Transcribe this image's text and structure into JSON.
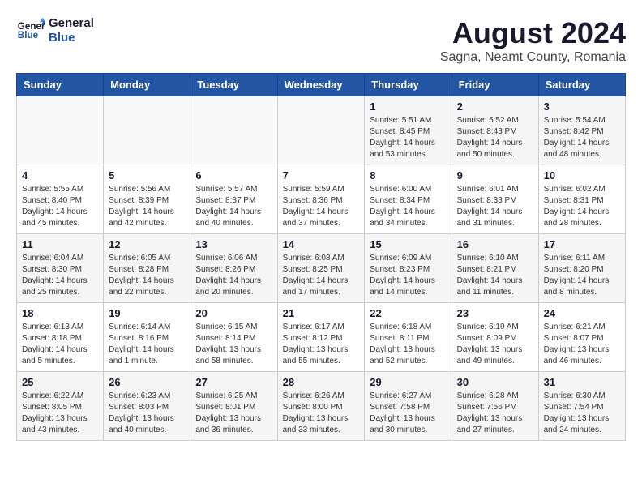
{
  "logo": {
    "line1": "General",
    "line2": "Blue"
  },
  "title": "August 2024",
  "subtitle": "Sagna, Neamt County, Romania",
  "weekdays": [
    "Sunday",
    "Monday",
    "Tuesday",
    "Wednesday",
    "Thursday",
    "Friday",
    "Saturday"
  ],
  "weeks": [
    [
      {
        "day": "",
        "info": ""
      },
      {
        "day": "",
        "info": ""
      },
      {
        "day": "",
        "info": ""
      },
      {
        "day": "",
        "info": ""
      },
      {
        "day": "1",
        "info": "Sunrise: 5:51 AM\nSunset: 8:45 PM\nDaylight: 14 hours\nand 53 minutes."
      },
      {
        "day": "2",
        "info": "Sunrise: 5:52 AM\nSunset: 8:43 PM\nDaylight: 14 hours\nand 50 minutes."
      },
      {
        "day": "3",
        "info": "Sunrise: 5:54 AM\nSunset: 8:42 PM\nDaylight: 14 hours\nand 48 minutes."
      }
    ],
    [
      {
        "day": "4",
        "info": "Sunrise: 5:55 AM\nSunset: 8:40 PM\nDaylight: 14 hours\nand 45 minutes."
      },
      {
        "day": "5",
        "info": "Sunrise: 5:56 AM\nSunset: 8:39 PM\nDaylight: 14 hours\nand 42 minutes."
      },
      {
        "day": "6",
        "info": "Sunrise: 5:57 AM\nSunset: 8:37 PM\nDaylight: 14 hours\nand 40 minutes."
      },
      {
        "day": "7",
        "info": "Sunrise: 5:59 AM\nSunset: 8:36 PM\nDaylight: 14 hours\nand 37 minutes."
      },
      {
        "day": "8",
        "info": "Sunrise: 6:00 AM\nSunset: 8:34 PM\nDaylight: 14 hours\nand 34 minutes."
      },
      {
        "day": "9",
        "info": "Sunrise: 6:01 AM\nSunset: 8:33 PM\nDaylight: 14 hours\nand 31 minutes."
      },
      {
        "day": "10",
        "info": "Sunrise: 6:02 AM\nSunset: 8:31 PM\nDaylight: 14 hours\nand 28 minutes."
      }
    ],
    [
      {
        "day": "11",
        "info": "Sunrise: 6:04 AM\nSunset: 8:30 PM\nDaylight: 14 hours\nand 25 minutes."
      },
      {
        "day": "12",
        "info": "Sunrise: 6:05 AM\nSunset: 8:28 PM\nDaylight: 14 hours\nand 22 minutes."
      },
      {
        "day": "13",
        "info": "Sunrise: 6:06 AM\nSunset: 8:26 PM\nDaylight: 14 hours\nand 20 minutes."
      },
      {
        "day": "14",
        "info": "Sunrise: 6:08 AM\nSunset: 8:25 PM\nDaylight: 14 hours\nand 17 minutes."
      },
      {
        "day": "15",
        "info": "Sunrise: 6:09 AM\nSunset: 8:23 PM\nDaylight: 14 hours\nand 14 minutes."
      },
      {
        "day": "16",
        "info": "Sunrise: 6:10 AM\nSunset: 8:21 PM\nDaylight: 14 hours\nand 11 minutes."
      },
      {
        "day": "17",
        "info": "Sunrise: 6:11 AM\nSunset: 8:20 PM\nDaylight: 14 hours\nand 8 minutes."
      }
    ],
    [
      {
        "day": "18",
        "info": "Sunrise: 6:13 AM\nSunset: 8:18 PM\nDaylight: 14 hours\nand 5 minutes."
      },
      {
        "day": "19",
        "info": "Sunrise: 6:14 AM\nSunset: 8:16 PM\nDaylight: 14 hours\nand 1 minute."
      },
      {
        "day": "20",
        "info": "Sunrise: 6:15 AM\nSunset: 8:14 PM\nDaylight: 13 hours\nand 58 minutes."
      },
      {
        "day": "21",
        "info": "Sunrise: 6:17 AM\nSunset: 8:12 PM\nDaylight: 13 hours\nand 55 minutes."
      },
      {
        "day": "22",
        "info": "Sunrise: 6:18 AM\nSunset: 8:11 PM\nDaylight: 13 hours\nand 52 minutes."
      },
      {
        "day": "23",
        "info": "Sunrise: 6:19 AM\nSunset: 8:09 PM\nDaylight: 13 hours\nand 49 minutes."
      },
      {
        "day": "24",
        "info": "Sunrise: 6:21 AM\nSunset: 8:07 PM\nDaylight: 13 hours\nand 46 minutes."
      }
    ],
    [
      {
        "day": "25",
        "info": "Sunrise: 6:22 AM\nSunset: 8:05 PM\nDaylight: 13 hours\nand 43 minutes."
      },
      {
        "day": "26",
        "info": "Sunrise: 6:23 AM\nSunset: 8:03 PM\nDaylight: 13 hours\nand 40 minutes."
      },
      {
        "day": "27",
        "info": "Sunrise: 6:25 AM\nSunset: 8:01 PM\nDaylight: 13 hours\nand 36 minutes."
      },
      {
        "day": "28",
        "info": "Sunrise: 6:26 AM\nSunset: 8:00 PM\nDaylight: 13 hours\nand 33 minutes."
      },
      {
        "day": "29",
        "info": "Sunrise: 6:27 AM\nSunset: 7:58 PM\nDaylight: 13 hours\nand 30 minutes."
      },
      {
        "day": "30",
        "info": "Sunrise: 6:28 AM\nSunset: 7:56 PM\nDaylight: 13 hours\nand 27 minutes."
      },
      {
        "day": "31",
        "info": "Sunrise: 6:30 AM\nSunset: 7:54 PM\nDaylight: 13 hours\nand 24 minutes."
      }
    ]
  ]
}
